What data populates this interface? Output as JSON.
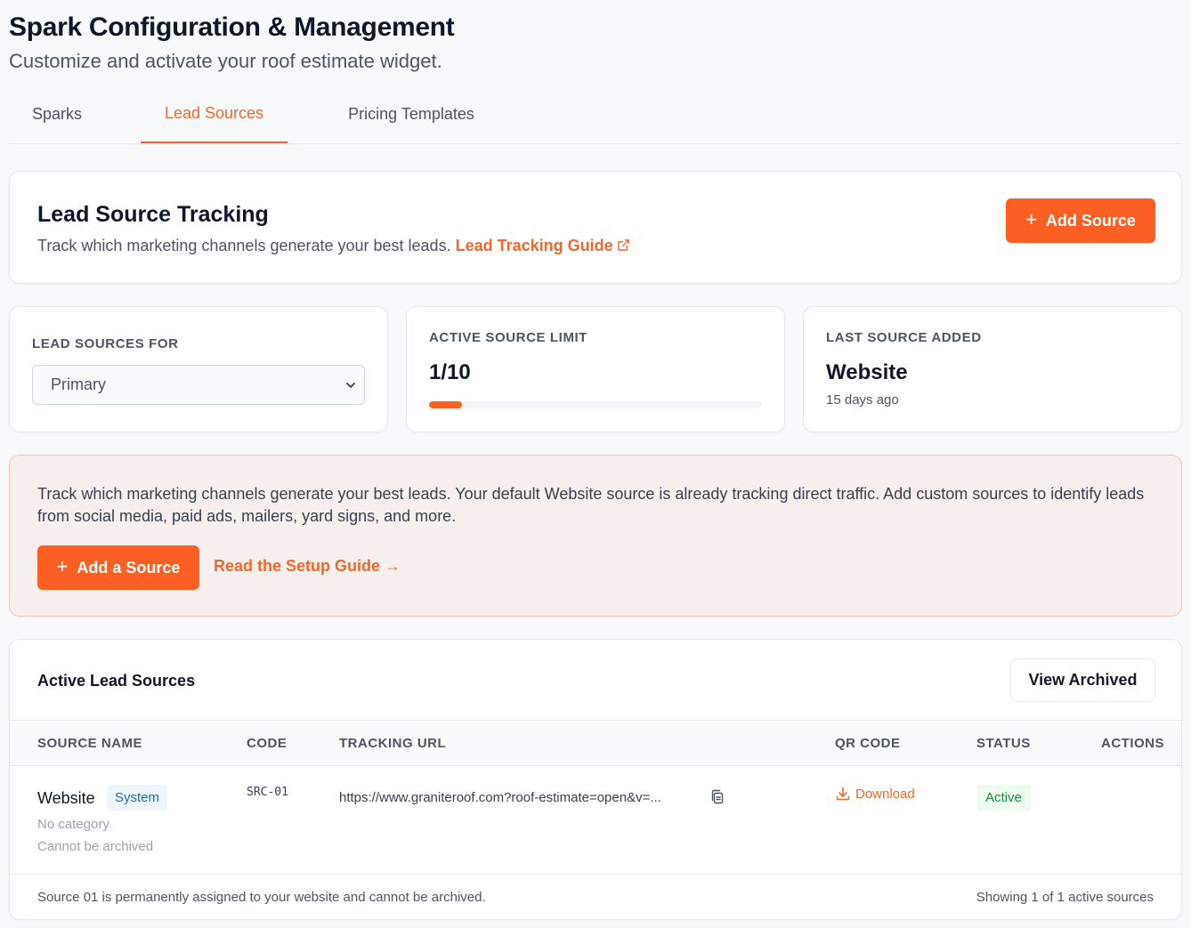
{
  "header": {
    "title": "Spark Configuration & Management",
    "subtitle": "Customize and activate your roof estimate widget."
  },
  "tabs": [
    {
      "label": "Sparks",
      "active": false
    },
    {
      "label": "Lead Sources",
      "active": true
    },
    {
      "label": "Pricing Templates",
      "active": false
    }
  ],
  "tracking": {
    "title": "Lead Source Tracking",
    "description": "Track which marketing channels generate your best leads.",
    "guide_link": "Lead Tracking Guide",
    "add_button": "Add Source"
  },
  "stats": {
    "lead_sources_for": {
      "label": "Lead Sources For",
      "selected": "Primary"
    },
    "active_limit": {
      "label": "Active Source Limit",
      "value": "1/10",
      "progress": 0.1
    },
    "last_added": {
      "label": "Last Source Added",
      "value": "Website",
      "sub": "15 days ago"
    }
  },
  "banner": {
    "text": "Track which marketing channels generate your best leads. Your default Website source is already tracking direct traffic. Add custom sources to identify leads from social media, paid ads, mailers, yard signs, and more.",
    "button": "Add a Source",
    "link": "Read the Setup Guide →"
  },
  "table": {
    "title": "Active Lead Sources",
    "view_archived": "View Archived",
    "columns": [
      "Source Name",
      "Code",
      "Tracking URL",
      "QR Code",
      "Status",
      "Actions"
    ],
    "rows": [
      {
        "name": "Website",
        "badge": "System",
        "category": "No category",
        "note": "Cannot be archived",
        "code": "SRC-01",
        "url": "https://www.graniteroof.com?roof-estimate=open&v=...",
        "qr": "Download",
        "status": "Active"
      }
    ],
    "footer_note": "Source 01 is permanently assigned to your website and cannot be archived.",
    "footer_count": "Showing 1 of 1 active sources"
  },
  "colors": {
    "accent": "#fb5f24",
    "link": "#f2672f",
    "banner_bg": "#f7efed",
    "active_badge": "#1f8a3b",
    "system_badge": "#1d6fa5"
  }
}
